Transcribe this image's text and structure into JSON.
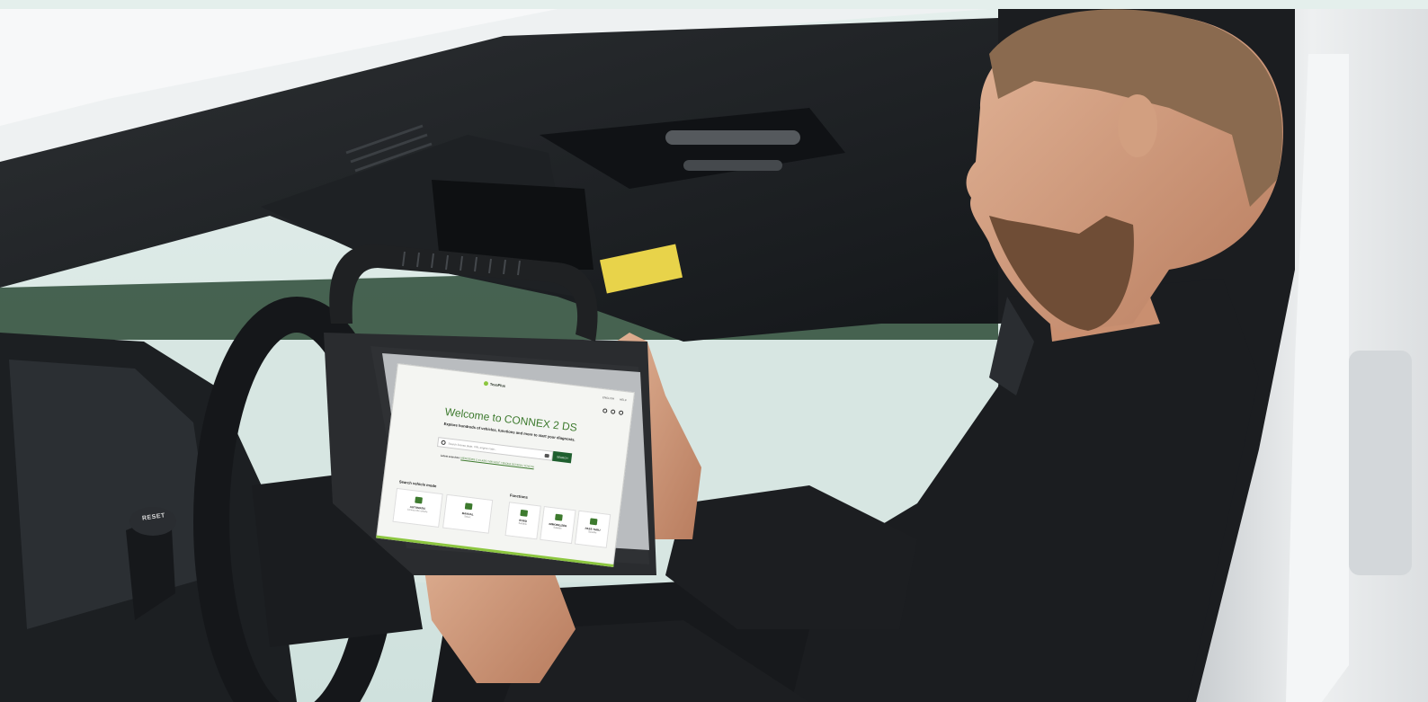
{
  "scene": {
    "reset_label": "RESET",
    "colors": {
      "accent": "#3d7a2e",
      "brand_green": "#8cc63f",
      "button": "#1f5f2f"
    }
  },
  "tablet_ui": {
    "logo": "TexaPlus",
    "top_links": [
      "ENGLISH",
      "HELP"
    ],
    "welcome": "Welcome to CONNEX 2 DS",
    "subtitle": "Explore hundreds of vehicles, functions and more to start your diagnosis.",
    "search": {
      "placeholder": "Search license plate, VIN, engine code...",
      "button": "SEARCH"
    },
    "latest_label": "Latest searches:",
    "latest_value": "MERCEDES C-CLASS / VW GOLF / SKODA OCTAVIA / TOYOTA",
    "sections": {
      "left": "Search vehicle mode",
      "right": "Functions"
    },
    "cards": [
      {
        "title": "AUTOMATIC",
        "sub": "Connect the vehicle"
      },
      {
        "title": "MANUAL",
        "sub": "Select"
      },
      {
        "title": "EOBD",
        "sub": "Suitable"
      },
      {
        "title": "IMMOBILIZER",
        "sub": "Suitable"
      },
      {
        "title": "PASS THRU",
        "sub": "Suitable"
      }
    ]
  }
}
